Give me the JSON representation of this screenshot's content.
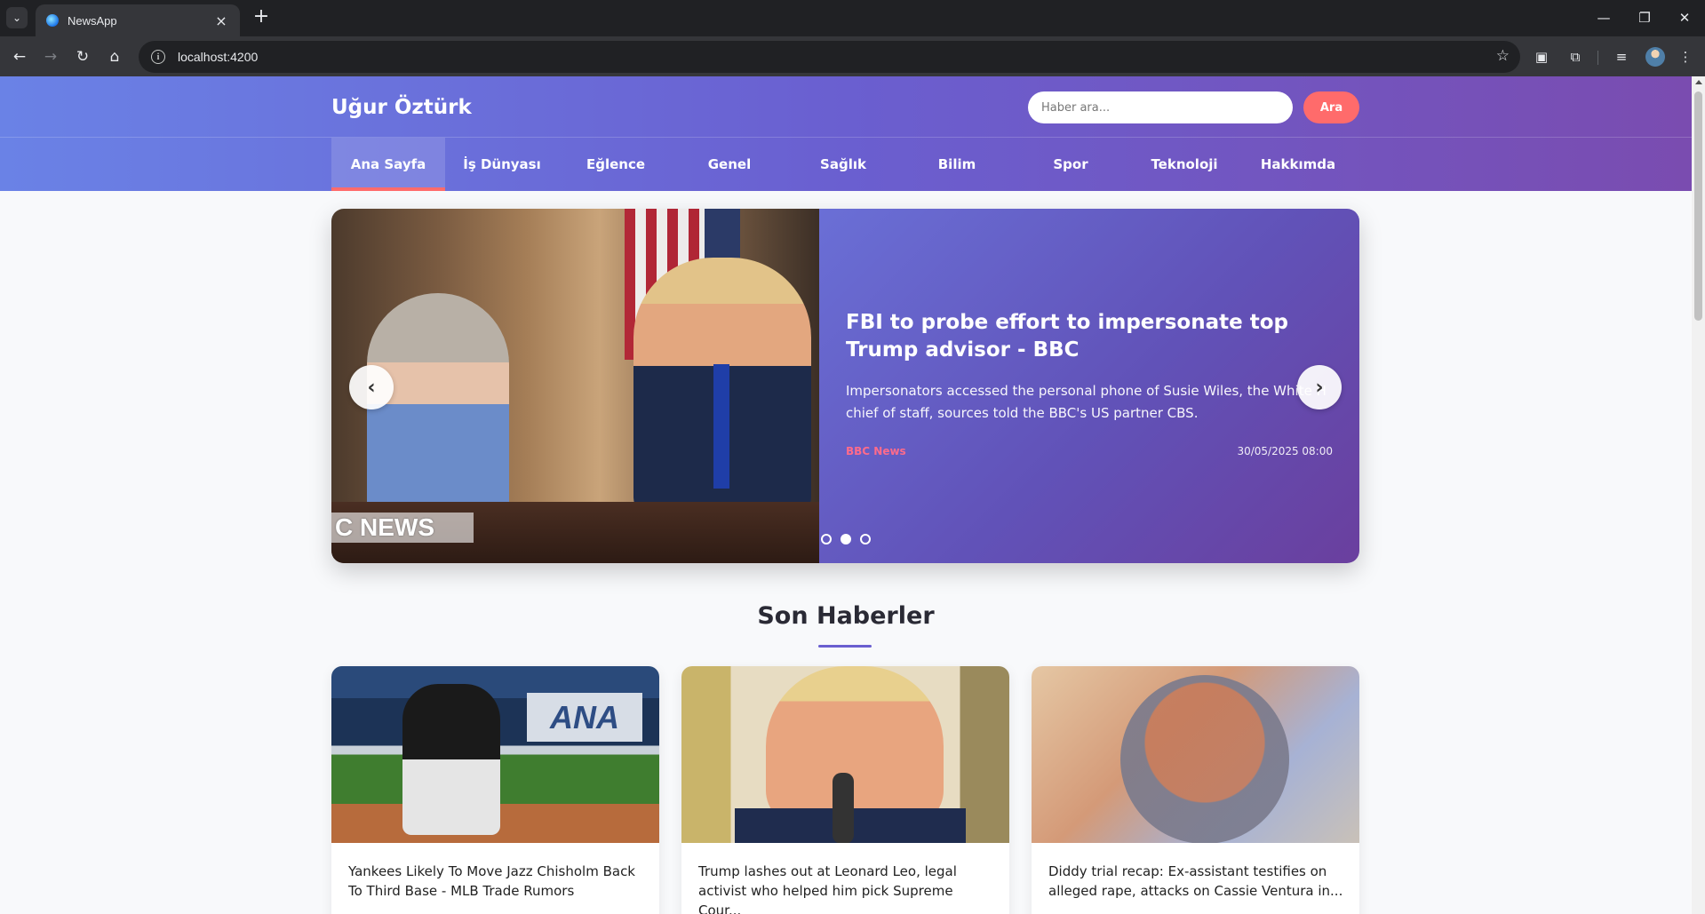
{
  "browser": {
    "tab_title": "NewsApp",
    "url": "localhost:4200"
  },
  "site": {
    "brand": "Uğur Öztürk",
    "search_placeholder": "Haber ara...",
    "search_button": "Ara",
    "nav": [
      "Ana Sayfa",
      "İş Dünyası",
      "Eğlence",
      "Genel",
      "Sağlık",
      "Bilim",
      "Spor",
      "Teknoloji",
      "Hakkımda"
    ],
    "active_nav": "Ana Sayfa",
    "accent_color": "#ff6b6b"
  },
  "carousel": {
    "title": "FBI to probe effort to impersonate top Trump advisor - BBC",
    "description": "Impersonators accessed the personal phone of Susie Wiles, the White House chief of staff, sources told the BBC's US partner CBS.",
    "description_line1": "Impersonators accessed the personal phone of Susie Wiles, the White House",
    "description_line2": "chief of staff, sources told the BBC's US partner CBS.",
    "source": "BBC News",
    "date": "30/05/2025 08:00",
    "image_watermark": "C NEWS",
    "prev_label": "‹",
    "next_label": "›",
    "slide_count": 3,
    "active_slide": 2
  },
  "section": {
    "title": "Son Haberler"
  },
  "articles": [
    {
      "title": "Yankees Likely To Move Jazz Chisholm Back To Third Base - MLB Trade Rumors",
      "image_text": "ANA"
    },
    {
      "title": "Trump lashes out at Leonard Leo, legal activist who helped him pick Supreme Cour..."
    },
    {
      "title": "Diddy trial recap: Ex-assistant testifies on alleged rape, attacks on Cassie Ventura in..."
    }
  ]
}
